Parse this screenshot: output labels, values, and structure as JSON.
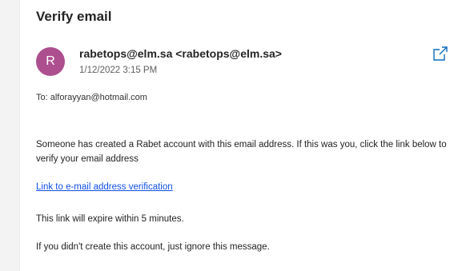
{
  "email": {
    "subject": "Verify email",
    "avatar_letter": "R",
    "sender": "rabetops@elm.sa <rabetops@elm.sa>",
    "datetime": "1/12/2022 3:15 PM",
    "to_label": "To: alforayyan@hotmail.com",
    "body": {
      "paragraph1": "Someone has created a Rabet account with this email address. If this was you, click the link below to verify your email address",
      "link_text": "Link to e-mail address verification",
      "paragraph2": "This link will expire within 5 minutes.",
      "paragraph3": "If you didn't create this account, just ignore this message."
    }
  },
  "colors": {
    "avatar": "#ad4f8f",
    "link": "#0f4fe6",
    "popout_icon": "#0f6cbd"
  },
  "icons": {
    "popout": "open-in-new-window-icon"
  }
}
